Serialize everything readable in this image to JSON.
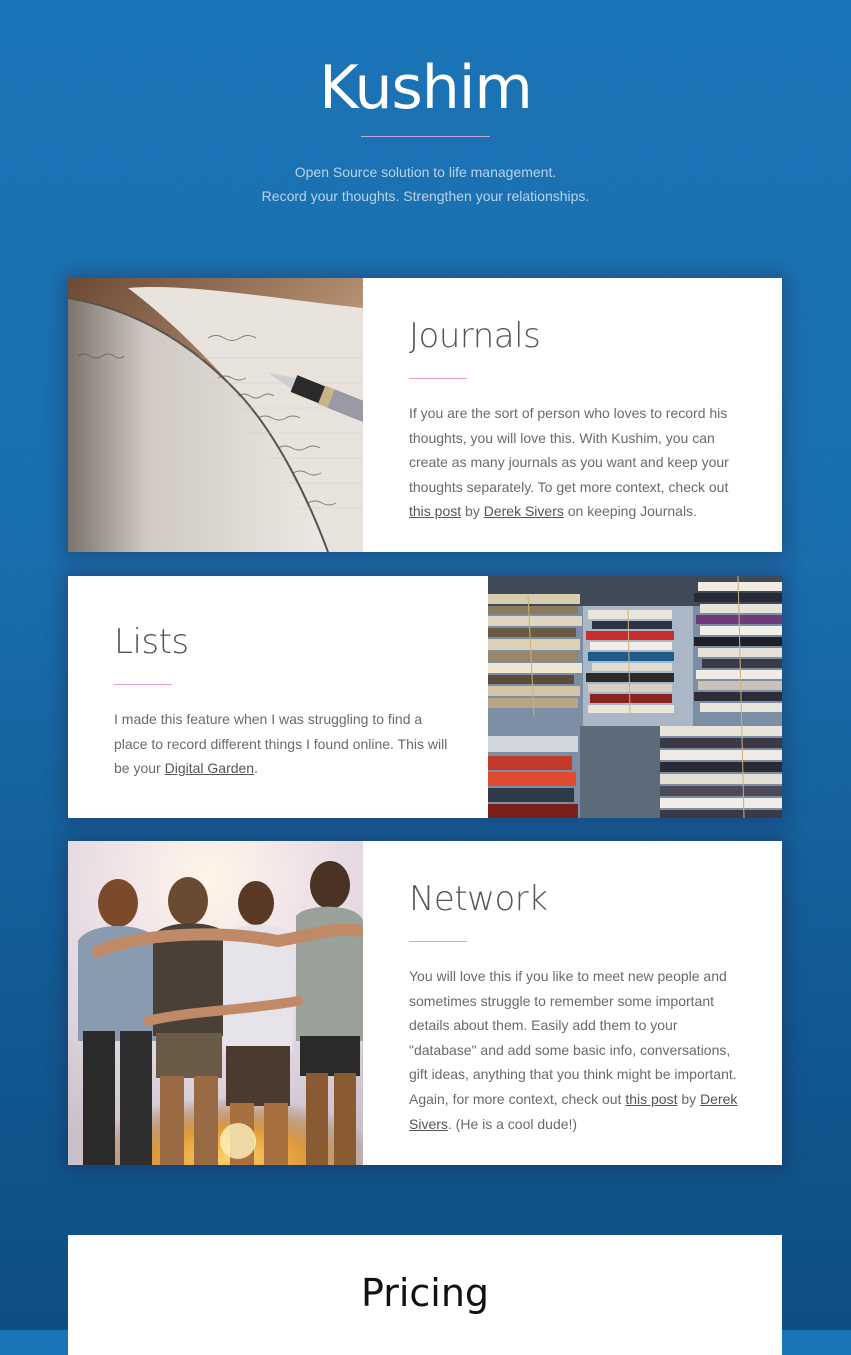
{
  "hero": {
    "title": "Kushim",
    "tagline_1": "Open Source solution to life management.",
    "tagline_2": "Record your thoughts. Strengthen your relationships."
  },
  "journals": {
    "heading": "Journals",
    "body_1": "If you are the sort of person who loves to record his thoughts, you will love this. With Kushim, you can create as many journals as you want and keep your thoughts separately. To get more context, check out ",
    "link_1": "this post",
    "body_2": " by ",
    "link_2": "Derek Sivers",
    "body_3": " on keeping Journals."
  },
  "lists": {
    "heading": "Lists",
    "body_1": "I made this feature when I was struggling to find a place to record different things I found online. This will be your ",
    "link_1": "Digital Garden",
    "body_2": "."
  },
  "network": {
    "heading": "Network",
    "body_1": "You will love this if you like to meet new people and sometimes struggle to remember some important details about them. Easily add them to your \"database\" and add some basic info, conversations, gift ideas, anything that you think might be important. Again, for more context, check out ",
    "link_1": "this post",
    "body_2": " by ",
    "link_2": "Derek Sivers",
    "body_3": ". (He is a cool dude!)"
  },
  "pricing": {
    "heading": "Pricing"
  },
  "colors": {
    "background": "#1b74b6",
    "accent_rule": "#e79bc5",
    "card": "#ffffff"
  }
}
